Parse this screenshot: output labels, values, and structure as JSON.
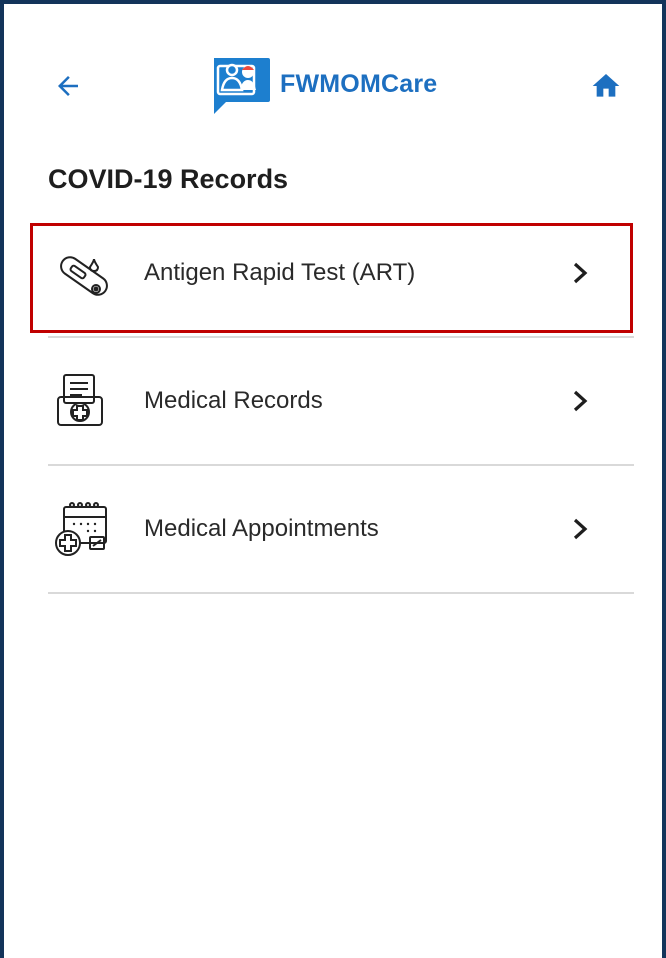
{
  "app": {
    "name": "FWMOMCare",
    "brand_color": "#1d6fc0",
    "frame_color": "#13345a"
  },
  "header": {
    "back_icon": "arrow-left-icon",
    "home_icon": "home-icon",
    "logo_icon": "fwmomcare-logo-icon"
  },
  "page": {
    "title": "COVID-19 Records"
  },
  "list": {
    "items": [
      {
        "label": "Antigen Rapid Test (ART)",
        "icon": "test-kit-icon",
        "highlighted": true
      },
      {
        "label": "Medical Records",
        "icon": "medical-record-icon",
        "highlighted": false
      },
      {
        "label": "Medical Appointments",
        "icon": "calendar-medical-icon",
        "highlighted": false
      }
    ],
    "chevron_icon": "chevron-right-icon"
  },
  "highlight_color": "#c00000"
}
